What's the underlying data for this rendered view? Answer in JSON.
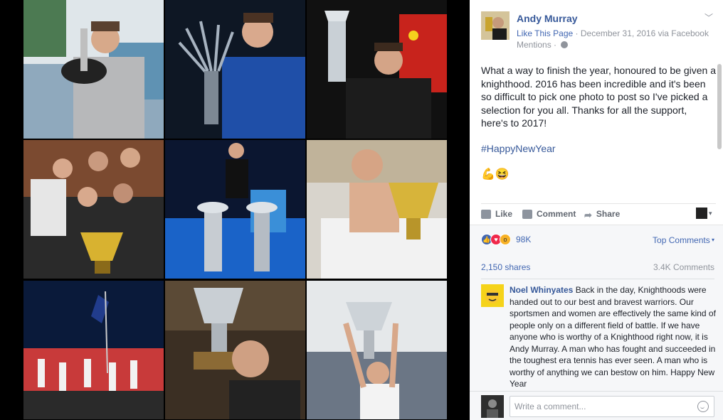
{
  "viewer": {
    "photos": [
      {
        "id": "bb-trophy-poolside",
        "caption": ""
      },
      {
        "id": "paris-trophy",
        "caption": ""
      },
      {
        "id": "shanghai-trophy",
        "caption": ""
      },
      {
        "id": "team-davis-cup",
        "caption": ""
      },
      {
        "id": "atp-finals-trophies",
        "caption": ""
      },
      {
        "id": "bath-wimbledon-trophy",
        "caption": ""
      },
      {
        "id": "olympic-flag-bearer",
        "caption": ""
      },
      {
        "id": "kissing-trophy",
        "caption": ""
      },
      {
        "id": "queens-trophy",
        "caption": ""
      }
    ]
  },
  "post": {
    "page_name": "Andy Murray",
    "like_page": "Like This Page",
    "date": "December 31, 2016",
    "via": "via Facebook",
    "mentions": "Mentions",
    "body": "What a way to finish the year, honoured to be given a knighthood. 2016 has been incredible and it's been so difficult to pick one photo to post so I've picked a selection for you all. Thanks for all the support, here's to 2017!",
    "hashtag": "#HappyNewYear",
    "emoji_line": "💪😆"
  },
  "actions": {
    "like": "Like",
    "comment": "Comment",
    "share": "Share"
  },
  "stats": {
    "reactions_count": "98K",
    "top_comments": "Top Comments",
    "shares": "2,150 shares",
    "comments": "3.4K Comments"
  },
  "comment": {
    "author": "Noel Whinyates",
    "text": "Back in the day, Knighthoods were handed out to our best and bravest warriors. Our sportsmen and women are effectively the same kind of people only on a different field of battle. If we have anyone who is worthy of a Knighthood right now, it is Andy Murray. A man who has fought and succeeded in the toughest era tennis has ever seen. A man who is worthy of anything we can bestow on him. Happy New Year"
  },
  "composer": {
    "placeholder": "Write a comment..."
  },
  "colors": {
    "link": "#365899",
    "accent": "#4267b2",
    "muted": "#90949c"
  }
}
